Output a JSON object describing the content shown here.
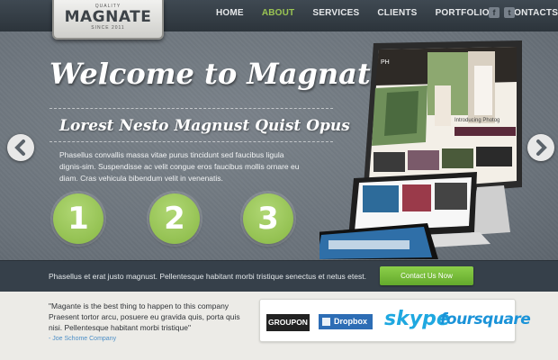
{
  "logo": {
    "top": "QUALITY",
    "name": "MAGNATE",
    "bottom": "SINCE 2011"
  },
  "nav": [
    "HOME",
    "ABOUT",
    "SERVICES",
    "CLIENTS",
    "PORTFOLIO",
    "CONTACTS"
  ],
  "nav_active": "ABOUT",
  "social": [
    {
      "icon": "facebook-icon",
      "glyph": "f"
    },
    {
      "icon": "twitter-icon",
      "glyph": "t"
    }
  ],
  "hero": {
    "title": "Welcome to Magnate",
    "subtitle": "Lorest Nesto Magnust Quist Opus",
    "body": "Phasellus convallis massa vitae purus tincidunt sed faucibus ligula dignis-sim. Suspendisse ac velit congue eros faucibus mollis ornare eu diam. Cras vehicula bibendum velit in venenatis.",
    "steps": [
      "1",
      "2",
      "3"
    ],
    "arrows": {
      "prev": "arrow-left-icon",
      "next": "arrow-right-icon"
    }
  },
  "mockup_text": {
    "site_name": "PH",
    "tagline": "Introducing Photog"
  },
  "strip": {
    "text": "Phasellus et erat justo magnust. Pellentesque habitant morbi tristique senectus et netus etest.",
    "button": "Contact Us Now"
  },
  "testimonial": {
    "quote": "\"Magante is the best thing to happen to this company Praesent tortor arcu, posuere eu gravida quis, porta quis nisi. Pellentesque habitant morbi tristique\"",
    "author": "- Joe Schome Company"
  },
  "clients": [
    "GROUPON",
    "Dropbox",
    "skype",
    "foursquare"
  ],
  "colors": {
    "accent_green": "#9bc553",
    "header_bg": "#2c343b",
    "button_green": "#7abd3c",
    "link_blue": "#4d8fc7"
  }
}
